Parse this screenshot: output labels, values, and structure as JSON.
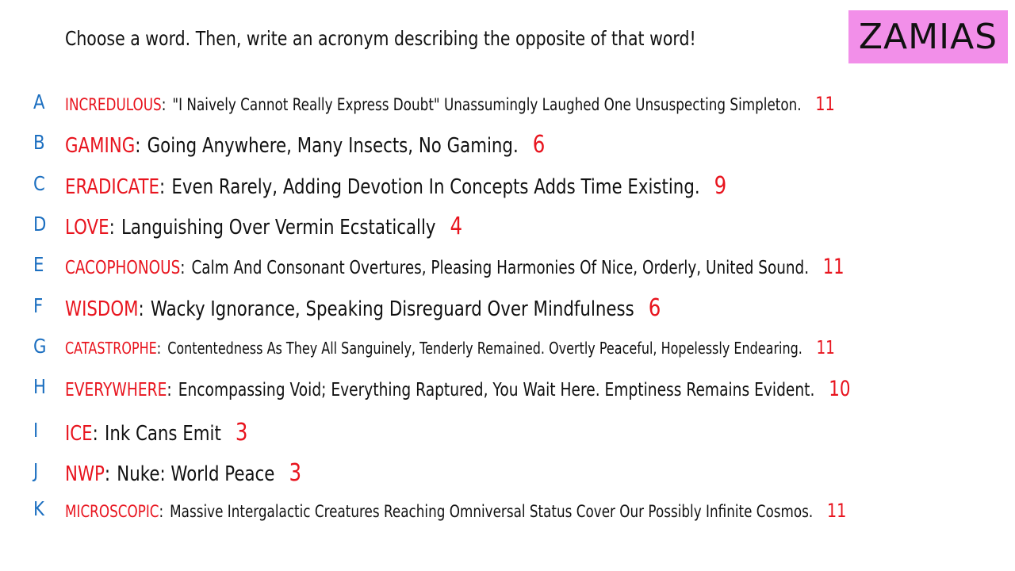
{
  "header": {
    "instruction": "Choose a word. Then, write an acronym describing the opposite of that word!",
    "badge": "ZAMIAS"
  },
  "colors": {
    "accent": "#e8141e",
    "letter": "#1c6fc0",
    "text": "#111111",
    "badge_bg": "#f28fe9"
  },
  "items": [
    {
      "letter": "A",
      "word": "INCREDULOUS",
      "acronym": "\"I Naively Cannot Really Express Doubt\" Unassumingly Laughed One Unsuspecting Simpleton.",
      "count": "11"
    },
    {
      "letter": "B",
      "word": "GAMING",
      "acronym": "Going Anywhere, Many Insects, No Gaming.",
      "count": "6"
    },
    {
      "letter": "C",
      "word": "ERADICATE",
      "acronym": "Even Rarely, Adding Devotion In Concepts Adds Time Existing.",
      "count": "9"
    },
    {
      "letter": "D",
      "word": "LOVE",
      "acronym": "Languishing Over Vermin Ecstatically",
      "count": "4"
    },
    {
      "letter": "E",
      "word": "CACOPHONOUS",
      "acronym": "Calm And Consonant Overtures, Pleasing Harmonies Of Nice, Orderly, United Sound.",
      "count": "11"
    },
    {
      "letter": "F",
      "word": "WISDOM",
      "acronym": "Wacky Ignorance, Speaking Disreguard Over Mindfulness",
      "count": "6"
    },
    {
      "letter": "G",
      "word": "CATASTROPHE",
      "acronym": "Contentedness As They All Sanguinely, Tenderly Remained. Overtly Peaceful, Hopelessly Endearing.",
      "count": "11"
    },
    {
      "letter": "H",
      "word": "EVERYWHERE",
      "acronym": "Encompassing Void; Everything Raptured, You Wait Here. Emptiness Remains Evident.",
      "count": "10"
    },
    {
      "letter": "I",
      "word": "ICE",
      "acronym": "Ink Cans Emit",
      "count": "3"
    },
    {
      "letter": "J",
      "word": "NWP",
      "acronym": "Nuke: World Peace",
      "count": "3"
    },
    {
      "letter": "K",
      "word": "MICROSCOPIC",
      "acronym": "Massive Intergalactic Creatures Reaching Omniversal Status Cover Our Possibly Infinite Cosmos.",
      "count": "11"
    }
  ]
}
